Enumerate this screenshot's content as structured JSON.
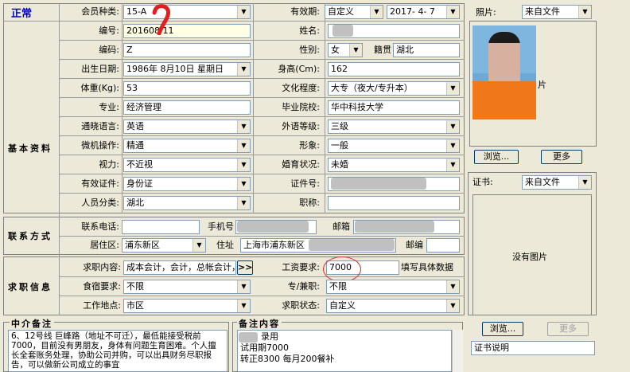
{
  "status": "正常",
  "sections": {
    "basic": "基本资料",
    "contact": "联系方式",
    "job": "求职信息",
    "agency_notes": "中介备注",
    "notes": "备注内容"
  },
  "labels": {
    "member_type": "会员种类:",
    "validity": "有效期:",
    "number": "编号:",
    "name": "姓名:",
    "code": "编码:",
    "gender": "性别:",
    "native": "籍贯",
    "birth": "出生日期:",
    "height": "身高(Cm):",
    "weight": "体重(Kg):",
    "education": "文化程度:",
    "major": "专业:",
    "school": "毕业院校:",
    "language": "通晓语言:",
    "foreign_level": "外语等级:",
    "computer": "微机操作:",
    "image": "形象:",
    "eyesight": "视力:",
    "marital": "婚育状况:",
    "id_type": "有效证件:",
    "id_no": "证件号:",
    "category": "人员分类:",
    "job_title": "职称:",
    "phone": "联系电话:",
    "mobile": "手机号",
    "email": "邮箱",
    "district": "居住区:",
    "address": "住址",
    "postcode": "邮编",
    "position": "求职内容:",
    "salary": "工资要求:",
    "salary_note": "填写具体数据",
    "board": "食宿要求:",
    "fulltime": "专/兼职:",
    "location": "工作地点:",
    "job_status": "求职状态:",
    "photo": "照片:",
    "cert": "证书:"
  },
  "values": {
    "member_type": "15-A",
    "validity_type": "自定义",
    "validity_date": "2017- 4- 7",
    "number": "201608 11",
    "code": "Z",
    "gender": "女",
    "native": "湖北",
    "birth": "1986年 8月10日 星期日",
    "height": "162",
    "weight": "53",
    "education": "大专（夜大/专升本）",
    "major": "经济管理",
    "school": "华中科技大学",
    "language": "英语",
    "foreign_level": "三级",
    "computer": "精通",
    "image": "一般",
    "eyesight": "不近视",
    "marital": "未婚",
    "id_type": "身份证",
    "category": "湖北",
    "district": "浦东新区",
    "address": "上海市浦东新区",
    "position": "成本会计，会计，总帐会计，",
    "salary": "7000",
    "board": "不限",
    "fulltime": "不限",
    "location": "市区",
    "job_status": "自定义",
    "photo_source": "来自文件",
    "cert_source": "来自文件",
    "cert_desc": "证书说明",
    "photo_hint": "片",
    "no_image": "没有图片"
  },
  "buttons": {
    "more_position": ">>",
    "browse": "浏览...",
    "more": "更多"
  },
  "agency_notes_text": "6、12号线 巨峰路（地址不可迁），最低能接受税前7000，目前没有男朋友，身体有问题生育困难。个人擅长全套账务处理，协助公司并购，可以出具财务尽职报告，可以做新公司成立的事宜",
  "notes_lines": [
    "录用",
    "试用期7000",
    "转正8300    每月200餐补"
  ]
}
